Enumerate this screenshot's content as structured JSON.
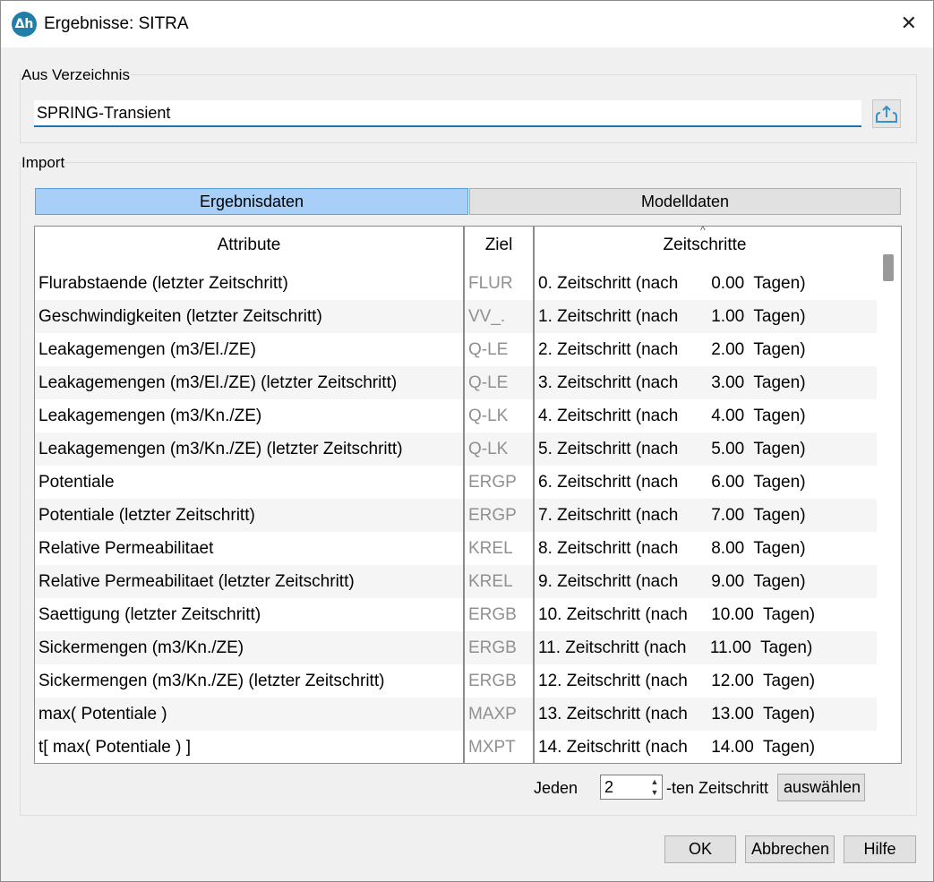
{
  "window": {
    "title": "Ergebnisse: SITRA",
    "icon_text": "Δh"
  },
  "directory": {
    "group_label": "Aus Verzeichnis",
    "value": "SPRING-Transient"
  },
  "import": {
    "group_label": "Import",
    "tabs": [
      {
        "label": "Ergebnisdaten",
        "active": true
      },
      {
        "label": "Modelldaten",
        "active": false
      }
    ],
    "columns": {
      "attribute": "Attribute",
      "ziel": "Ziel",
      "zeitschritte": "Zeitschritte"
    },
    "rows": [
      {
        "attribute": "Flurabstaende (letzter Zeitschritt)",
        "ziel": "FLUR",
        "zeitschritt": "0. Zeitschritt (nach       0.00  Tagen)"
      },
      {
        "attribute": "Geschwindigkeiten (letzter Zeitschritt)",
        "ziel": "VV_.",
        "zeitschritt": "1. Zeitschritt (nach       1.00  Tagen)"
      },
      {
        "attribute": "Leakagemengen (m3/El./ZE)",
        "ziel": "Q-LE",
        "zeitschritt": "2. Zeitschritt (nach       2.00  Tagen)"
      },
      {
        "attribute": "Leakagemengen (m3/El./ZE) (letzter Zeitschritt)",
        "ziel": "Q-LE",
        "zeitschritt": "3. Zeitschritt (nach       3.00  Tagen)"
      },
      {
        "attribute": "Leakagemengen (m3/Kn./ZE)",
        "ziel": "Q-LK",
        "zeitschritt": "4. Zeitschritt (nach       4.00  Tagen)"
      },
      {
        "attribute": "Leakagemengen (m3/Kn./ZE) (letzter Zeitschritt)",
        "ziel": "Q-LK",
        "zeitschritt": "5. Zeitschritt (nach       5.00  Tagen)"
      },
      {
        "attribute": "Potentiale",
        "ziel": "ERGP",
        "zeitschritt": "6. Zeitschritt (nach       6.00  Tagen)"
      },
      {
        "attribute": "Potentiale (letzter Zeitschritt)",
        "ziel": "ERGP",
        "zeitschritt": "7. Zeitschritt (nach       7.00  Tagen)"
      },
      {
        "attribute": "Relative Permeabilitaet",
        "ziel": "KREL",
        "zeitschritt": "8. Zeitschritt (nach       8.00  Tagen)"
      },
      {
        "attribute": "Relative Permeabilitaet (letzter Zeitschritt)",
        "ziel": "KREL",
        "zeitschritt": "9. Zeitschritt (nach       9.00  Tagen)"
      },
      {
        "attribute": "Saettigung (letzter Zeitschritt)",
        "ziel": "ERGB",
        "zeitschritt": "10. Zeitschritt (nach     10.00  Tagen)"
      },
      {
        "attribute": "Sickermengen (m3/Kn./ZE)",
        "ziel": "ERGB",
        "zeitschritt": "11. Zeitschritt (nach     11.00  Tagen)"
      },
      {
        "attribute": "Sickermengen (m3/Kn./ZE) (letzter Zeitschritt)",
        "ziel": "ERGB",
        "zeitschritt": "12. Zeitschritt (nach     12.00  Tagen)"
      },
      {
        "attribute": "max( Potentiale )",
        "ziel": "MAXP",
        "zeitschritt": "13. Zeitschritt (nach     13.00  Tagen)"
      },
      {
        "attribute": "t[ max( Potentiale ) ]",
        "ziel": "MXPT",
        "zeitschritt": "14. Zeitschritt (nach     14.00  Tagen)"
      }
    ]
  },
  "step_select": {
    "prefix": "Jeden",
    "value": "2",
    "suffix": "-ten Zeitschritt",
    "button": "auswählen"
  },
  "buttons": {
    "ok": "OK",
    "cancel": "Abbrechen",
    "help": "Hilfe"
  },
  "colors": {
    "active_tab": "#a8cff7",
    "input_underline": "#1a73b5",
    "ziel_text": "#909090"
  }
}
